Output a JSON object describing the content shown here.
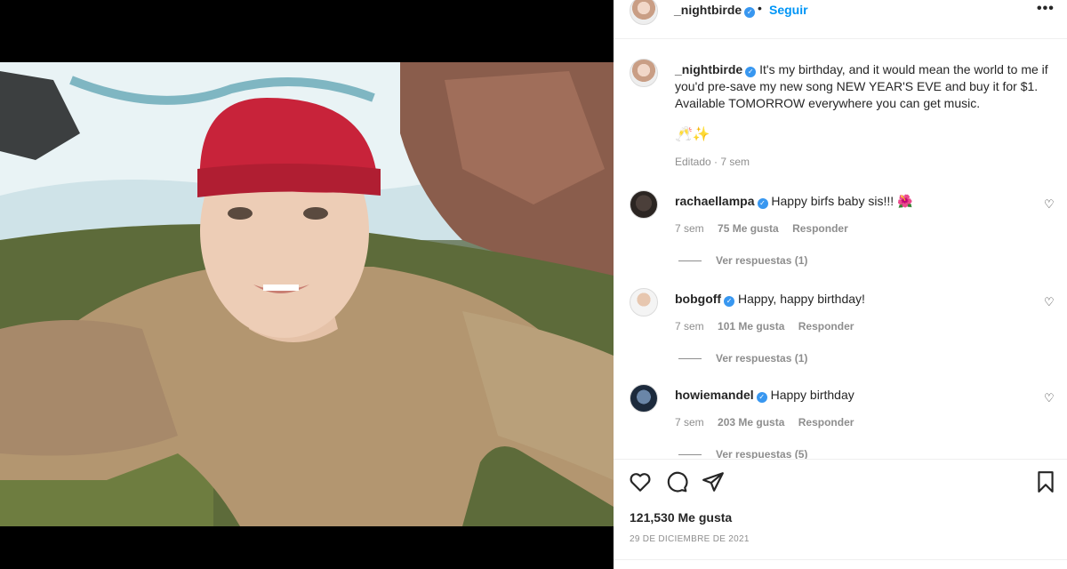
{
  "header": {
    "username": "_nightbirde",
    "dot": "•",
    "follow": "Seguir",
    "more": "•••"
  },
  "caption": {
    "username": "_nightbirde",
    "text": "It's my birthday, and it would mean the world to me if you'd pre-save my new song NEW YEAR'S EVE and buy it for $1. Available TOMORROW everywhere you can get music.",
    "emojis": "🥂✨",
    "edited": "Editado · 7 sem"
  },
  "comments": [
    {
      "username": "rachaellampa",
      "text": "Happy birfs baby sis!!! 🌺",
      "time": "7 sem",
      "likes": "75 Me gusta",
      "reply": "Responder",
      "replies": "Ver respuestas (1)"
    },
    {
      "username": "bobgoff",
      "text": "Happy, happy birthday!",
      "time": "7 sem",
      "likes": "101 Me gusta",
      "reply": "Responder",
      "replies": "Ver respuestas (1)"
    },
    {
      "username": "howiemandel",
      "text": "Happy birthday",
      "time": "7 sem",
      "likes": "203 Me gusta",
      "reply": "Responder",
      "replies": "Ver respuestas (5)"
    }
  ],
  "footer": {
    "likes": "121,530 Me gusta",
    "date": "29 DE DICIEMBRE DE 2021"
  },
  "icons": {
    "like": "heart-icon",
    "comment": "comment-icon",
    "share": "share-icon",
    "save": "bookmark-icon"
  },
  "colors": {
    "link": "#0095f6",
    "verified": "#3897f0",
    "muted": "#8e8e8e"
  }
}
